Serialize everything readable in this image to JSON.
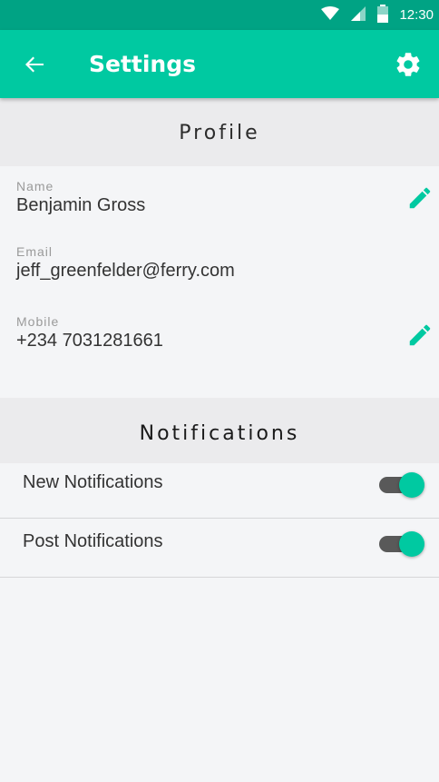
{
  "status_bar": {
    "time": "12:30",
    "icons": [
      "wifi-icon",
      "signal-icon",
      "battery-icon"
    ]
  },
  "app_bar": {
    "title": "Settings",
    "left_icon": "arrow-back-icon",
    "right_icon": "gear-icon"
  },
  "profile": {
    "header": "Profile",
    "name": {
      "label": "Name",
      "value": "Benjamin Gross",
      "action_icon": "edit-pencil-icon"
    },
    "email": {
      "label": "Email",
      "value": "jeff_greenfelder@ferry.com"
    },
    "mobile": {
      "label": "Mobile",
      "value": "+234 7031281661",
      "action_icon": "edit-pencil-icon"
    }
  },
  "notifications": {
    "header": "Notifications",
    "items": [
      {
        "label": "New Notifications",
        "enabled": true
      },
      {
        "label": "Post Notifications",
        "enabled": true
      }
    ]
  },
  "colors": {
    "status_bar": "#00a384",
    "app_bar": "#00c9a1",
    "accent": "#00c9a1",
    "toggle_track": "#595959",
    "section_bg": "#ebebed",
    "page_bg": "#f4f5f7"
  }
}
